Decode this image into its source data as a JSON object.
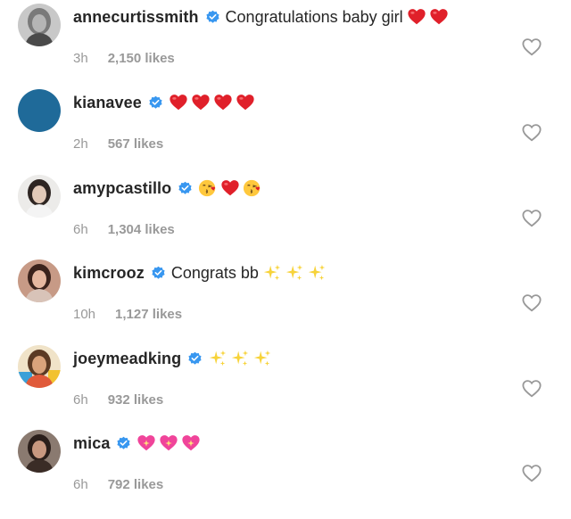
{
  "comments": [
    {
      "username": "annecurtissmith",
      "text": "Congratulations baby girl",
      "emoji": [
        "red-heart",
        "red-heart"
      ],
      "time": "3h",
      "likes": "2,150 likes",
      "avatar": "photo-woman-grayscale",
      "avatar_color": "#9a9a9a"
    },
    {
      "username": "kianavee",
      "text": "",
      "emoji": [
        "red-heart",
        "red-heart",
        "red-heart",
        "red-heart"
      ],
      "time": "2h",
      "likes": "567 likes",
      "avatar": "solid-blue",
      "avatar_color": "#1f6a99"
    },
    {
      "username": "amypcastillo",
      "text": "",
      "emoji": [
        "kissing-face",
        "red-heart",
        "kissing-face"
      ],
      "time": "6h",
      "likes": "1,304 likes",
      "avatar": "photo-woman-light",
      "avatar_color": "#d9d4d0"
    },
    {
      "username": "kimcrooz",
      "text": "Congrats bb",
      "emoji": [
        "sparkles",
        "sparkles",
        "sparkles"
      ],
      "time": "10h",
      "likes": "1,127 likes",
      "avatar": "photo-woman-warm",
      "avatar_color": "#b58a7a"
    },
    {
      "username": "joeymeadking",
      "text": "",
      "emoji": [
        "sparkles",
        "sparkles",
        "sparkles"
      ],
      "time": "6h",
      "likes": "932 likes",
      "avatar": "photo-colorful",
      "avatar_color": "#c9a46a"
    },
    {
      "username": "mica",
      "text": "",
      "emoji": [
        "sparkling-heart",
        "sparkling-heart",
        "sparkling-heart"
      ],
      "time": "6h",
      "likes": "792 likes",
      "avatar": "photo-woman-dark",
      "avatar_color": "#5a4a42"
    }
  ],
  "colors": {
    "verified_badge": "#3897f0",
    "red_heart": "#e0202a",
    "sparkling_heart": "#f0449a",
    "sparkles": "#f7d33a",
    "kiss_face": "#ffc83d",
    "meta_text": "#999999",
    "like_outline": "#999999"
  }
}
